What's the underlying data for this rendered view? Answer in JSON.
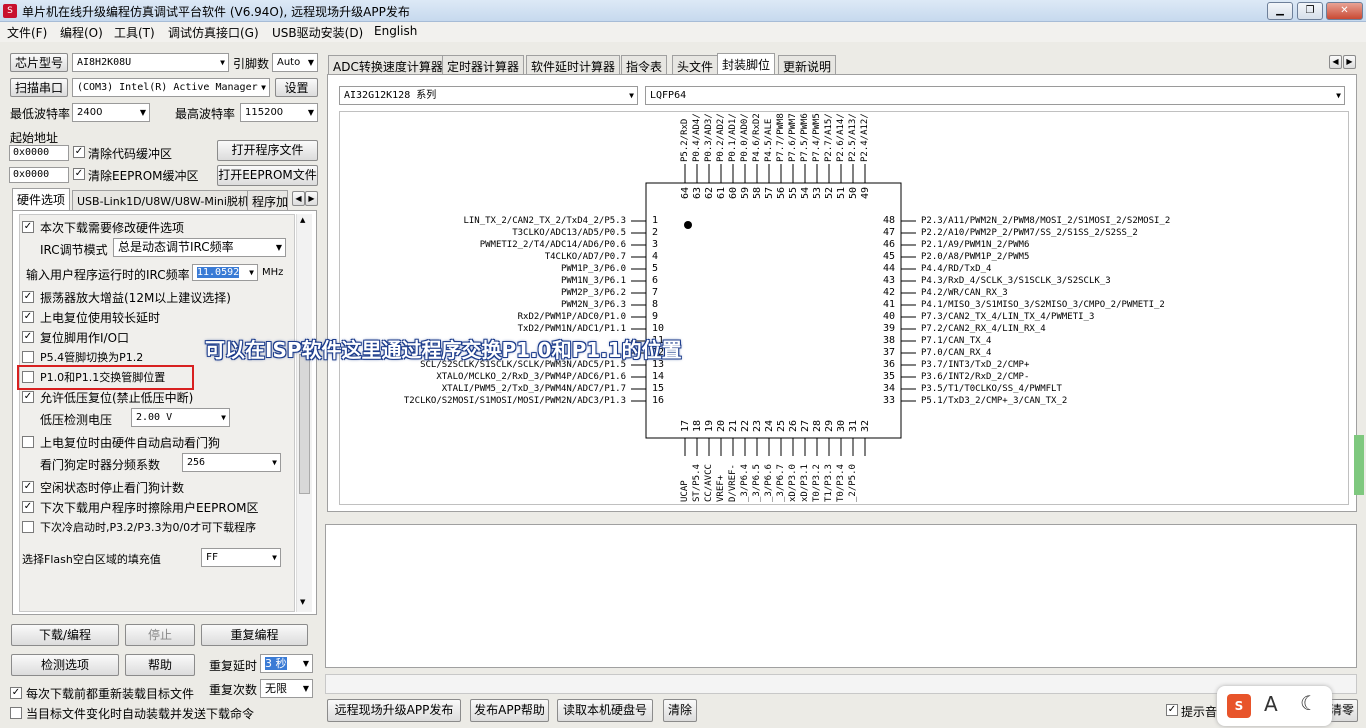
{
  "window": {
    "title": "单片机在线升级编程仿真调试平台软件 (V6.94O), 远程现场升级APP发布"
  },
  "menu": [
    "文件(F)",
    "编程(O)",
    "工具(T)",
    "调试仿真接口(G)",
    "USB驱动安装(D)",
    "English"
  ],
  "left": {
    "chip_btn": "芯片型号",
    "chip_value": "AI8H2K08U",
    "pin_label": "引脚数",
    "pin_value": "Auto",
    "scan_btn": "扫描串口",
    "port_value": "(COM3) Intel(R) Active Manager",
    "settings_btn": "设置",
    "min_baud_label": "最低波特率",
    "min_baud": "2400",
    "max_baud_label": "最高波特率",
    "max_baud": "115200",
    "start_addr_label": "起始地址",
    "addr1": "0x0000",
    "clear_code": "清除代码缓冲区",
    "open_prog": "打开程序文件",
    "addr2": "0x0000",
    "clear_eeprom": "清除EEPROM缓冲区",
    "open_eeprom": "打开EEPROM文件",
    "tabs": [
      "硬件选项",
      "USB-Link1D/U8W/U8W-Mini脱机",
      "程序加"
    ]
  },
  "options": {
    "o1": "本次下载需要修改硬件选项",
    "irc_label": "IRC调节模式",
    "irc_value": "总是动态调节IRC频率",
    "freq_label": "输入用户程序运行时的IRC频率",
    "freq_value": "11.0592",
    "freq_unit": "MHz",
    "o2": "振荡器放大增益(12M以上建议选择)",
    "o3": "上电复位使用较长延时",
    "o4": "复位脚用作I/O口",
    "o5": "P5.4管脚切换为P1.2",
    "o6": "P1.0和P1.1交换管脚位置",
    "o7": "允许低压复位(禁止低压中断)",
    "lv_label": "低压检测电压",
    "lv_value": "2.00 V",
    "o8": "上电复位时由硬件自动启动看门狗",
    "wd_label": "看门狗定时器分频系数",
    "wd_value": "256",
    "o9": "空闲状态时停止看门狗计数",
    "o10": "下次下载用户程序时擦除用户EEPROM区",
    "o11": "下次冷启动时,P3.2/P3.3为0/0才可下载程序",
    "fill_label": "选择Flash空白区域的填充值",
    "fill_value": "FF"
  },
  "bottom": {
    "download": "下载/编程",
    "stop": "停止",
    "reprogram": "重复编程",
    "check": "检测选项",
    "help": "帮助",
    "delay_label": "重复延时",
    "delay_value": "3 秒",
    "count_label": "重复次数",
    "count_value": "无限",
    "reload1": "每次下载前都重新装载目标文件",
    "reload2": "当目标文件变化时自动装载并发送下载命令"
  },
  "right_tabs": [
    "ADC转换速度计算器",
    "定时器计算器",
    "软件延时计算器",
    "指令表",
    "头文件",
    "封装脚位",
    "更新说明"
  ],
  "series_value": "AI32G12K128 系列",
  "package_value": "LQFP64",
  "annotation": "可以在ISP软件这里通过程序交换P1.0和P1.1的位置",
  "pins": {
    "left": [
      "LIN_TX_2/CAN2_TX_2/TxD4_2/P5.3",
      "T3CLKO/ADC13/AD5/P0.5",
      "PWMETI2_2/T4/ADC14/AD6/P0.6",
      "T4CLKO/AD7/P0.7",
      "PWM1P_3/P6.0",
      "PWM1N_3/P6.1",
      "PWM2P_3/P6.2",
      "PWM2N_3/P6.3",
      "RxD2/PWM1P/ADC0/P1.0",
      "TxD2/PWM1N/ADC1/P1.1",
      "",
      "",
      "SCL/S2SCLK/S1SCLK/SCLK/PWM3N/ADC5/P1.5",
      "XTALO/MCLKO_2/RxD_3/PWM4P/ADC6/P1.6",
      "XTALI/PWM5_2/TxD_3/PWM4N/ADC7/P1.7",
      "T2CLKO/S2MOSI/S1MOSI/MOSI/PWM2N/ADC3/P1.3"
    ],
    "right": [
      "P2.3/A11/PWM2N_2/PWM8/MOSI_2/S1MOSI_2/S2MOSI_2",
      "P2.2/A10/PWM2P_2/PWM7/SS_2/S1SS_2/S2SS_2",
      "P2.1/A9/PWM1N_2/PWM6",
      "P2.0/A8/PWM1P_2/PWM5",
      "P4.4/RD/TxD_4",
      "P4.3/RxD_4/SCLK_3/S1SCLK_3/S2SCLK_3",
      "P4.2/WR/CAN_RX_3",
      "P4.1/MISO_3/S1MISO_3/S2MISO_3/CMPO_2/PWMETI_2",
      "P7.3/CAN2_TX_4/LIN_TX_4/PWMETI_3",
      "P7.2/CAN2_RX_4/LIN_RX_4",
      "P7.1/CAN_TX_4",
      "P7.0/CAN_RX_4",
      "P3.7/INT3/TxD_2/CMP+",
      "P3.6/INT2/RxD_2/CMP-",
      "P3.5/T1/T0CLKO/SS_4/PWMFLT",
      "P5.1/TxD3_2/CMP+_3/CAN_TX_2"
    ],
    "top_labels": [
      "P5.2/RxD",
      "P0.4/AD4/",
      "P0.3/AD3/",
      "P0.2/AD2/",
      "P0.1/AD1/",
      "P0.0/AD0/",
      "P4.6/RxD2",
      "P4.5/ALE",
      "P7.7/PWM8",
      "P7.6/PWM7",
      "P7.5/PWM6",
      "P7.4/PWM5",
      "P2.7/A15/",
      "P2.6/A14/",
      "P2.5/A13/",
      "P2.4/A12/"
    ],
    "bottom_labels": [
      "UCAP",
      "ST/P5.4",
      "CC/AVCC",
      "VREF+",
      "D/VREF-",
      "_3/P6.4",
      "_3/P6.5",
      "_3/P6.6",
      "_3/P6.7",
      "xD/P3.0",
      "xD/P3.1",
      "T0/P3.2",
      "T1/P3.3",
      "T0/P3.4",
      "_2/P5.0",
      ""
    ]
  },
  "footer": {
    "b1": "远程现场升级APP发布",
    "b2": "发布APP帮助",
    "b3": "读取本机硬盘号",
    "b4": "清除",
    "prompt": "提示音",
    "clear": "清零"
  }
}
